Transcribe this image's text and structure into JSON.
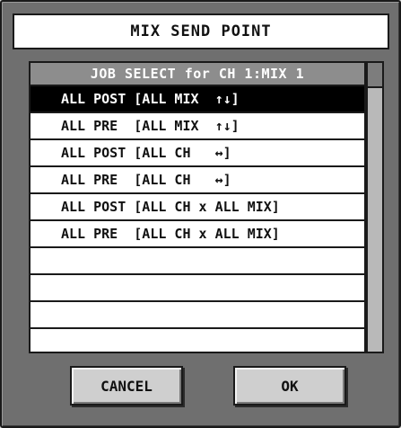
{
  "dialog": {
    "title": "MIX SEND POINT"
  },
  "list": {
    "header": "JOB SELECT for CH 1:MIX 1",
    "selected_index": 0,
    "items": [
      {
        "label": "ALL POST [ALL MIX  ↑↓]"
      },
      {
        "label": "ALL PRE  [ALL MIX  ↑↓]"
      },
      {
        "label": "ALL POST [ALL CH   ↔]"
      },
      {
        "label": "ALL PRE  [ALL CH   ↔]"
      },
      {
        "label": "ALL POST [ALL CH x ALL MIX]"
      },
      {
        "label": "ALL PRE  [ALL CH x ALL MIX]"
      },
      {
        "label": ""
      },
      {
        "label": ""
      },
      {
        "label": ""
      }
    ]
  },
  "buttons": {
    "cancel_label": "CANCEL",
    "ok_label": "OK"
  }
}
